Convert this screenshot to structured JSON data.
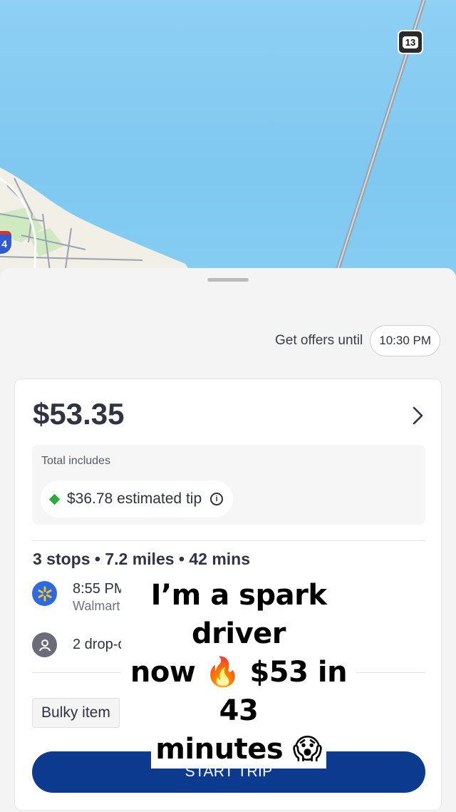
{
  "map": {
    "route_shield": "13",
    "interstate_shield": "4"
  },
  "sheet": {
    "offers_label": "Get offers until",
    "offers_time": "10:30 PM"
  },
  "offer": {
    "price": "$53.35",
    "total_includes_label": "Total includes",
    "tip_label": "$36.78 estimated tip",
    "summary": "3 stops • 7.2 miles • 42 mins",
    "stops": [
      {
        "time": "8:55 PM",
        "sub": "Walmart",
        "icon": "walmart-icon"
      },
      {
        "time": "2 drop-offs",
        "sub": "",
        "icon": "person-icon"
      }
    ],
    "tag": "Bulky item",
    "start_button": "START TRIP"
  },
  "caption": {
    "line1": "I’m a spark driver",
    "line2": "now 🔥 $53 in 43",
    "line3": "minutes 😱"
  },
  "colors": {
    "accent": "#0b3a8e",
    "tip_diamond": "#2faa3c",
    "water": "#7fc8f0"
  }
}
